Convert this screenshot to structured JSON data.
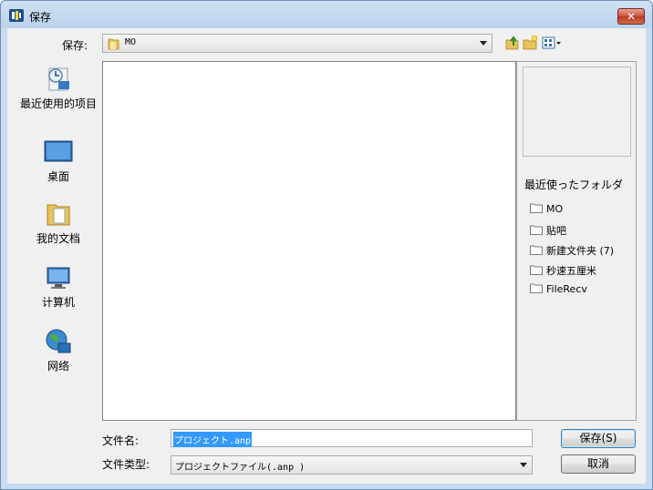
{
  "window": {
    "title": "保存",
    "close_glyph": "✕"
  },
  "toolbar": {
    "lookin_label": "保存:",
    "lookin_value": "MO",
    "icons": [
      "up-folder-icon",
      "new-folder-icon",
      "view-menu-icon"
    ]
  },
  "places": [
    {
      "label": "最近使用的项目",
      "icon": "recent-places-icon"
    },
    {
      "label": "桌面",
      "icon": "desktop-icon"
    },
    {
      "label": "我的文档",
      "icon": "documents-icon"
    },
    {
      "label": "计算机",
      "icon": "computer-icon"
    },
    {
      "label": "网络",
      "icon": "network-icon"
    }
  ],
  "recent_folders": {
    "title": "最近使ったフォルダ",
    "items": [
      "MO",
      "贴吧",
      "新建文件夹 (7)",
      "秒速五厘米",
      "FileRecv"
    ]
  },
  "form": {
    "filename_label": "文件名:",
    "filename_value": "プロジェクト.anp",
    "filetype_label": "文件类型:",
    "filetype_value": "プロジェクトファイル(.anp )"
  },
  "buttons": {
    "save": "保存(S)",
    "cancel": "取消"
  },
  "colors": {
    "selection": "#3399ff",
    "title_bar": "#bcd2ec",
    "close_button": "#c9503a"
  }
}
